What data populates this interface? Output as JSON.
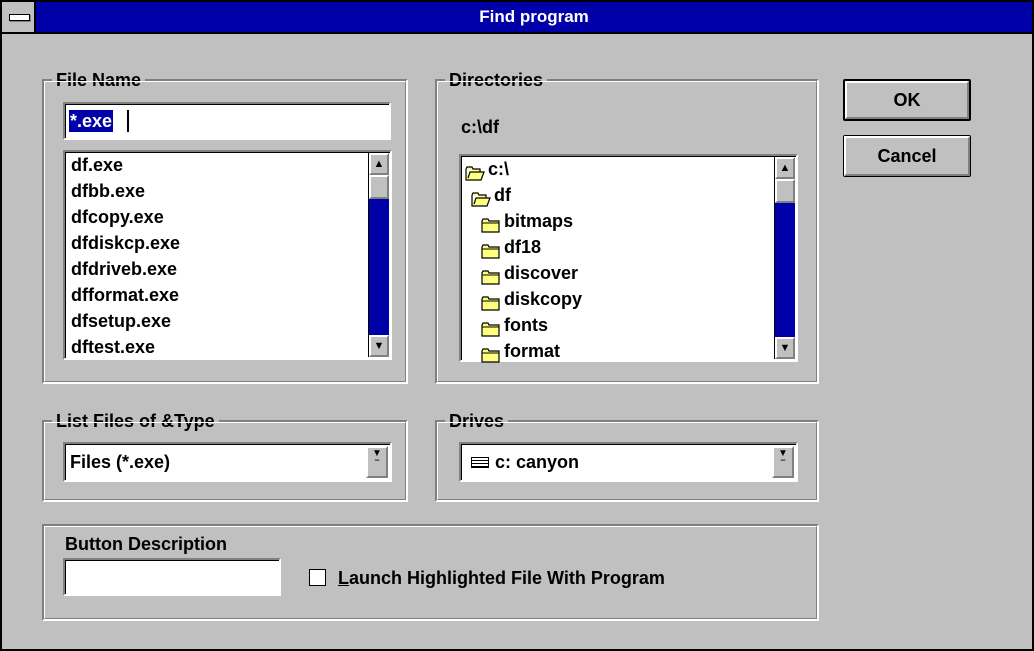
{
  "window": {
    "title": "Find program"
  },
  "file_name": {
    "label": "File Name",
    "value": "*.exe",
    "files": [
      "df.exe",
      "dfbb.exe",
      "dfcopy.exe",
      "dfdiskcp.exe",
      "dfdriveb.exe",
      "dfformat.exe",
      "dfsetup.exe",
      "dftest.exe"
    ]
  },
  "directories": {
    "label": "Directories",
    "current_path": "c:\\df",
    "tree": [
      {
        "name": "c:\\",
        "icon": "open-folder-icon"
      },
      {
        "name": "df",
        "icon": "open-folder-icon"
      },
      {
        "name": "bitmaps",
        "icon": "folder-icon"
      },
      {
        "name": "df18",
        "icon": "folder-icon"
      },
      {
        "name": "discover",
        "icon": "folder-icon"
      },
      {
        "name": "diskcopy",
        "icon": "folder-icon"
      },
      {
        "name": "fonts",
        "icon": "folder-icon"
      },
      {
        "name": "format",
        "icon": "folder-icon"
      }
    ]
  },
  "file_type": {
    "label": "List Files of &Type",
    "value": "Files (*.exe)"
  },
  "drives": {
    "label": "Drives",
    "value": "c: canyon",
    "icon": "drive-icon"
  },
  "buttons": {
    "ok": "OK",
    "cancel": "Cancel"
  },
  "button_description": {
    "label": "Button Description",
    "value": ""
  },
  "launch_checkbox": {
    "label_prefix": "L",
    "label_rest": "aunch Highlighted File With Program",
    "checked": false
  },
  "colors": {
    "title_bar": "#0000a8",
    "face": "#c0c0c0",
    "highlight": "#0000a8"
  }
}
